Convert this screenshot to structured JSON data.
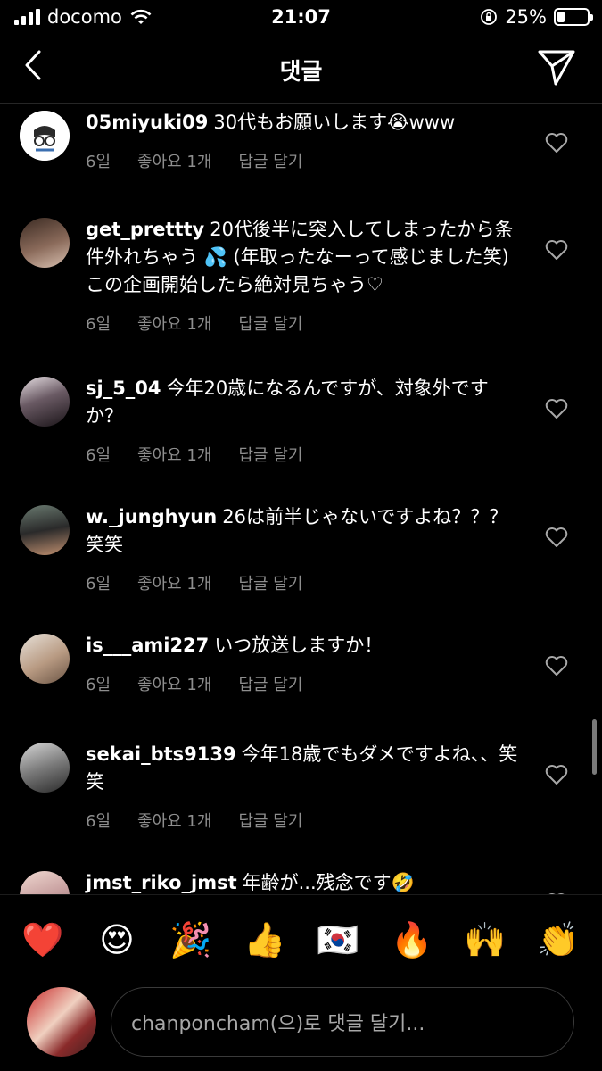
{
  "status_bar": {
    "carrier": "docomo",
    "time": "21:07",
    "battery": "25%",
    "battery_level": 0.25
  },
  "header": {
    "title": "댓글",
    "back_icon": "chevron-left-icon",
    "send_icon": "paper-plane-icon"
  },
  "comments": [
    {
      "username": "05miyuki09",
      "text": "30代もお願いします😭www",
      "time": "6일",
      "likes": "좋아요 1개",
      "reply": "답글 달기"
    },
    {
      "username": "get_prettty",
      "text": "20代後半に突入してしまったから条件外れちゃう 💦 (年取ったなーって感じました笑) この企画開始したら絶対見ちゃう♡",
      "time": "6일",
      "likes": "좋아요 1개",
      "reply": "답글 달기"
    },
    {
      "username": "sj_5_04",
      "text": "今年20歳になるんですが、対象外ですか？",
      "time": "6일",
      "likes": "좋아요 1개",
      "reply": "답글 달기"
    },
    {
      "username": "w._junghyun",
      "text": "26は前半じゃないですよね？？？笑笑",
      "time": "6일",
      "likes": "좋아요 1개",
      "reply": "답글 달기"
    },
    {
      "username": "is___ami227",
      "text": "いつ放送しますか！",
      "time": "6일",
      "likes": "좋아요 1개",
      "reply": "답글 달기"
    },
    {
      "username": "sekai_bts9139",
      "text": "今年18歳でもダメですよね、、笑笑",
      "time": "6일",
      "likes": "좋아요 1개",
      "reply": "답글 달기"
    },
    {
      "username": "jmst_riko_jmst",
      "text": "年齢が...残念です🤣",
      "time": "",
      "likes": "",
      "reply": ""
    }
  ],
  "reactions": [
    "❤️",
    "😍",
    "🎉",
    "👍",
    "🇰🇷",
    "🔥",
    "🙌",
    "👏"
  ],
  "input": {
    "placeholder": "chanponcham(으)로 댓글 달기..."
  },
  "colors": {
    "background": "#000000",
    "text": "#ffffff",
    "meta": "#8e8e8e"
  }
}
